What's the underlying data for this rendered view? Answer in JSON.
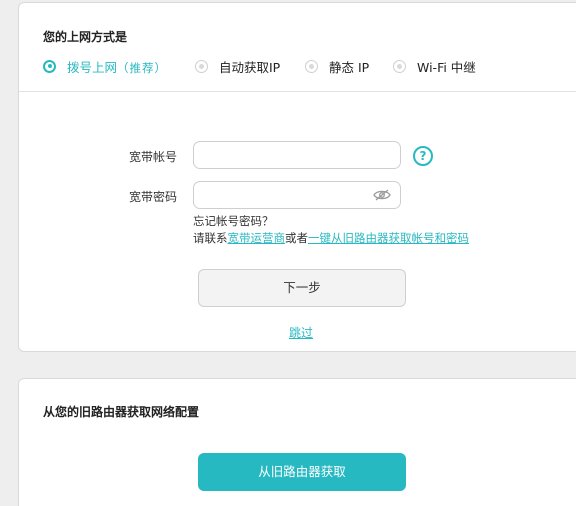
{
  "connection": {
    "title": "您的上网方式是",
    "options": [
      {
        "label": "拨号上网",
        "hint": "（推荐）",
        "selected": true
      },
      {
        "label": "自动获取IP",
        "selected": false
      },
      {
        "label": "静态 IP",
        "selected": false
      },
      {
        "label": "Wi-Fi 中继",
        "selected": false
      }
    ]
  },
  "form": {
    "account_label": "宽带帐号",
    "account_value": "",
    "password_label": "宽带密码",
    "password_value": "",
    "help_icon_glyph": "?",
    "forgot_line1": "忘记帐号密码？",
    "forgot_prefix": "请联系",
    "isp_link": "宽带运营商",
    "or_text": "或者",
    "old_router_link": "一键从旧路由器获取帐号和密码",
    "next_button": "下一步",
    "skip_link": "跳过"
  },
  "old_router": {
    "title": "从您的旧路由器获取网络配置",
    "button": "从旧路由器获取"
  },
  "colors": {
    "accent": "#27b9c2",
    "card_bg": "#ffffff",
    "page_bg": "#eeeeee"
  },
  "icons": {
    "help": "question-circle-icon",
    "password_visibility": "eye-hidden-icon",
    "radio_selected": "radio-checked-icon",
    "radio_unselected": "radio-unchecked-icon"
  }
}
